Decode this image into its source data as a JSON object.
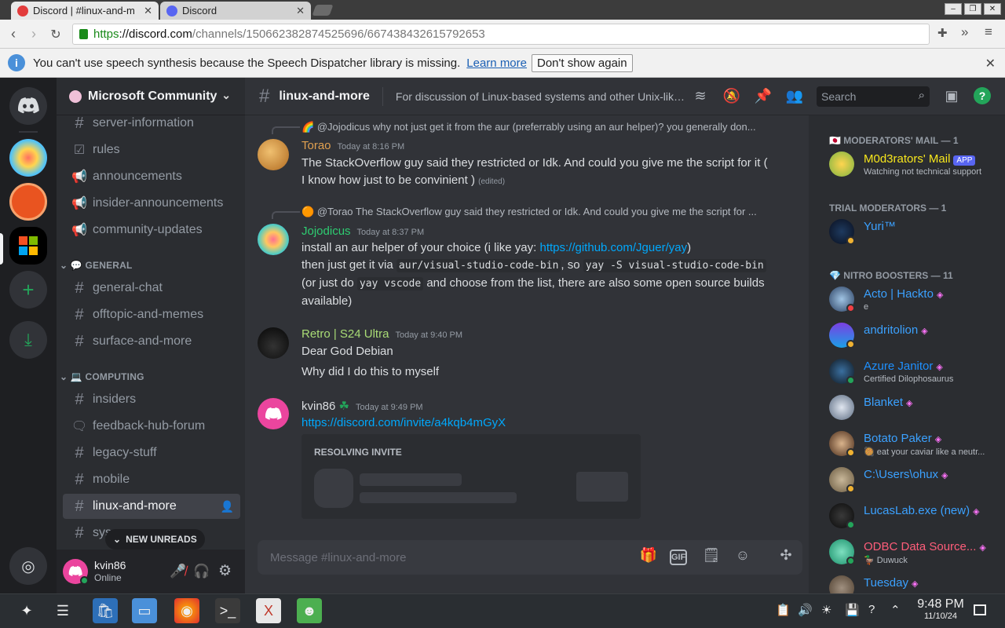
{
  "browser": {
    "tabs": [
      {
        "label": "Discord | #linux-and-more",
        "active": true
      },
      {
        "label": "Discord",
        "active": false
      }
    ],
    "url_https": "https",
    "url_domain": "://discord.com",
    "url_path": "/channels/150662382874525696/667438432615792653"
  },
  "infobar": {
    "message": "You can't use speech synthesis because the Speech Dispatcher library is missing.",
    "learn_more": "Learn more",
    "dont_show": "Don't show again"
  },
  "server": {
    "name": "Microsoft Community",
    "channels_top": [
      "server-information",
      "rules",
      "announcements",
      "insider-announcements",
      "community-updates"
    ],
    "category_general": "GENERAL",
    "channels_general": [
      "general-chat",
      "offtopic-and-memes",
      "surface-and-more"
    ],
    "category_computing": "COMPUTING",
    "channels_computing": [
      "insiders",
      "feedback-hub-forum",
      "legacy-stuff",
      "mobile",
      "linux-and-more",
      "sys"
    ],
    "new_unreads": "NEW UNREADS"
  },
  "user": {
    "name": "kvin86",
    "status": "Online"
  },
  "channel": {
    "name": "linux-and-more",
    "topic": "For discussion of Linux-based systems and other Unix-like ...",
    "search_placeholder": "Search",
    "composer_placeholder": "Message #linux-and-more"
  },
  "messages": [
    {
      "reply_author": "@Jojodicus",
      "reply_text": "why not just get it from the aur (preferrably using an aur helper)? you generally don...",
      "author": "Torao",
      "author_color": "#e0a050",
      "time": "Today at 8:16 PM",
      "text": "The StackOverflow guy said they restricted or Idk. And could you give me the script for it ( I know how just to be convinient )",
      "edited": "(edited)"
    },
    {
      "reply_author": "@Torao",
      "reply_text": "The StackOverflow guy said they restricted or Idk. And could you give me the script for ...",
      "author": "Jojodicus",
      "author_color": "#2ecc71",
      "time": "Today at 8:37 PM",
      "text1": "install an aur helper of your choice (i like yay: ",
      "link1": "https://github.com/Jguer/yay",
      "text1b": ")",
      "text2": "then just get it via ",
      "code1": "aur/visual-studio-code-bin",
      "text3": ", so ",
      "code2": "yay -S visual-studio-code-bin",
      "text4": " (or just do ",
      "code3": "yay vscode",
      "text5": " and choose from the list, there are also some open source builds available)"
    },
    {
      "author": "Retro | S24 Ultra",
      "author_color": "#a9dc76",
      "time": "Today at 9:40 PM",
      "line1": "Dear God Debian",
      "line2": "Why did I do this to myself"
    },
    {
      "author": "kvin86",
      "author_color": "#dbdee1",
      "time": "Today at 9:49 PM",
      "link": "https://discord.com/invite/a4kqb4mGyX",
      "invite_title": "RESOLVING INVITE"
    }
  ],
  "members": {
    "cat_modmail": "MODERATORS' MAIL — 1",
    "cat_trial": "TRIAL MODERATORS — 1",
    "cat_boosters": "NITRO BOOSTERS — 11",
    "modmail": {
      "name": "M0d3rators' Mail",
      "badge": "APP",
      "sub": "Watching not technical support"
    },
    "trial": {
      "name": "Yuri™"
    },
    "boosters": [
      {
        "name": "Acto | Hackto",
        "sub": "e",
        "color": "#3ba1ff"
      },
      {
        "name": "andritolion",
        "sub": "",
        "color": "#3ba1ff"
      },
      {
        "name": "Azure Janitor",
        "sub": "Certified Dilophosaurus",
        "color": "#1e90ff"
      },
      {
        "name": "Blanket",
        "sub": "",
        "color": "#3ba1ff"
      },
      {
        "name": "Botato Paker",
        "sub": "eat your caviar like a neutr...",
        "color": "#3ba1ff"
      },
      {
        "name": "C:\\Users\\ohux",
        "sub": "",
        "color": "#3ba1ff"
      },
      {
        "name": "LucasLab.exe (new)",
        "sub": "",
        "color": "#3ba1ff"
      },
      {
        "name": "ODBC Data Source...",
        "sub": "Duwuck",
        "color": "#ff5d7a"
      },
      {
        "name": "Tuesday",
        "sub": "",
        "color": "#3ba1ff"
      }
    ]
  },
  "taskbar": {
    "time": "9:48 PM",
    "date": "11/10/24"
  }
}
